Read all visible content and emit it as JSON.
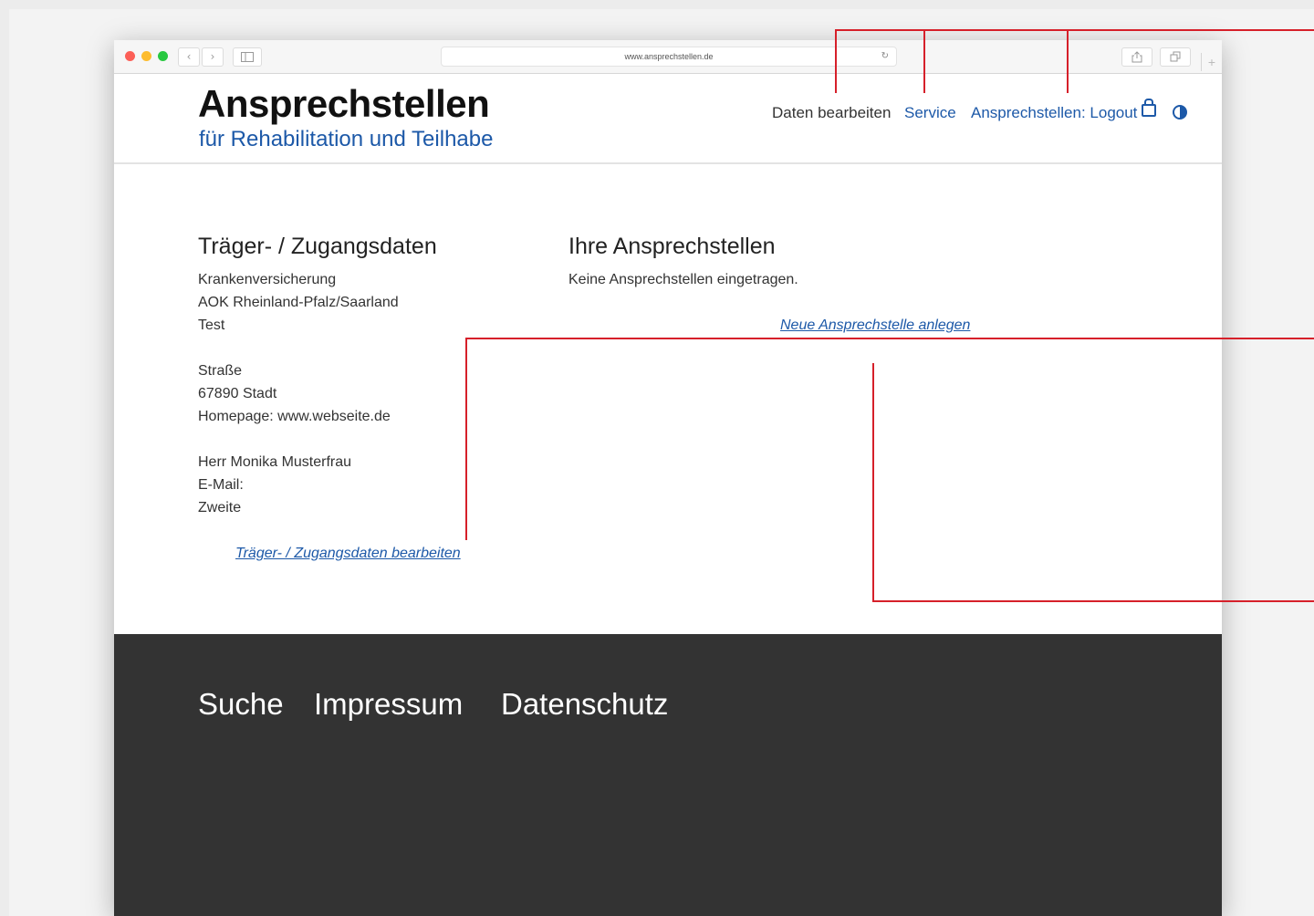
{
  "browser": {
    "url": "www.ansprechstellen.de",
    "back_icon": "‹",
    "forward_icon": "›",
    "reload_icon": "↻",
    "new_tab_label": "+"
  },
  "header": {
    "title": "Ansprechstellen",
    "subtitle": "für Rehabilitation und Teilhabe",
    "nav": {
      "daten": "Daten bearbeiten",
      "service": "Service",
      "logout": "Ansprechstellen: Logout"
    }
  },
  "left": {
    "title": "Träger- / Zugangsdaten",
    "lines": [
      "Krankenversicherung",
      "AOK Rheinland-Pfalz/Saarland",
      "Test",
      "Straße",
      "67890 Stadt",
      "Homepage: www.webseite.de",
      "Herr Monika Musterfrau",
      "E-Mail:",
      "Zweite"
    ],
    "edit_link": "Träger- / Zugangsdaten bearbeiten"
  },
  "right": {
    "title": "Ihre Ansprechstellen",
    "empty_text": "Keine Ansprechstellen eingetragen.",
    "new_link": "Neue Ansprechstelle anlegen"
  },
  "footer": {
    "links": [
      "Suche",
      "Impressum",
      "Datenschutz"
    ]
  },
  "colors": {
    "brand_blue": "#1d59a8",
    "callout_red": "#d6202a",
    "footer_bg": "#333333"
  }
}
